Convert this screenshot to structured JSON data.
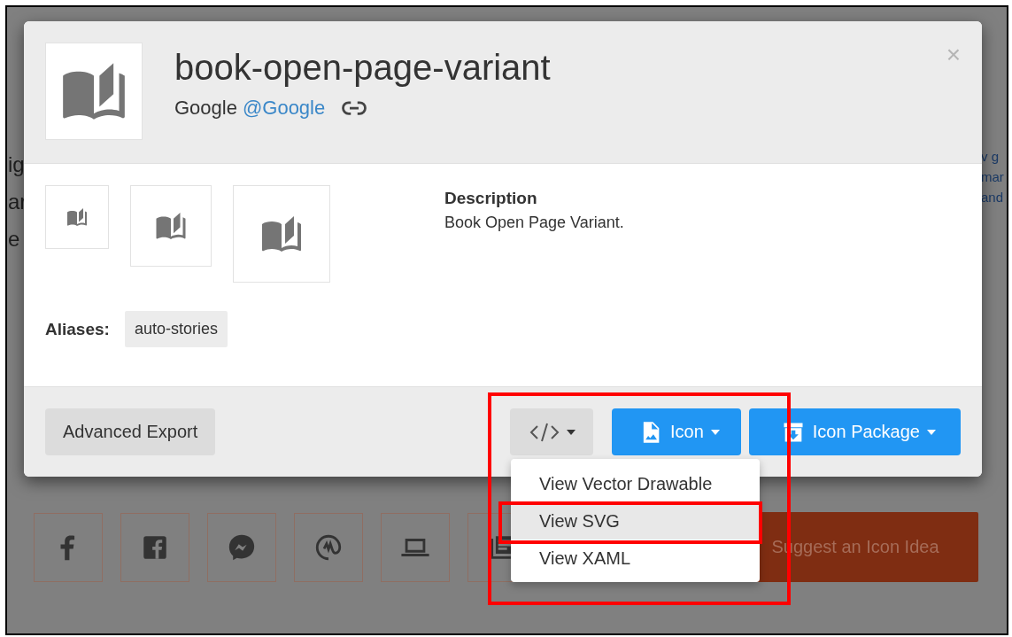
{
  "page": {
    "left_fragments": [
      "ig",
      "ar",
      "e"
    ],
    "right_fragments": [
      "v g",
      "mar",
      "and"
    ],
    "tiles": [
      {
        "kind": "facebook"
      },
      {
        "kind": "facebook-box"
      },
      {
        "kind": "messenger"
      },
      {
        "kind": "workplace"
      },
      {
        "kind": "laptop"
      },
      {
        "kind": "document"
      }
    ],
    "suggest_button": "Suggest an Icon Idea"
  },
  "modal": {
    "title": "book-open-page-variant",
    "author": "Google",
    "author_handle": "@Google",
    "close": "×",
    "previews": [
      {
        "kind": "small"
      },
      {
        "kind": "medium"
      },
      {
        "kind": "large"
      }
    ],
    "description_label": "Description",
    "description": "Book Open Page Variant.",
    "aliases_label": "Aliases:",
    "aliases": [
      "auto-stories"
    ],
    "footer": {
      "advanced_export": "Advanced Export",
      "icon_button": "Icon",
      "package_button": "Icon Package"
    }
  },
  "menu": {
    "items": [
      {
        "label": "View Vector Drawable",
        "selected": false
      },
      {
        "label": "View SVG",
        "selected": true
      },
      {
        "label": "View XAML",
        "selected": false
      }
    ]
  }
}
